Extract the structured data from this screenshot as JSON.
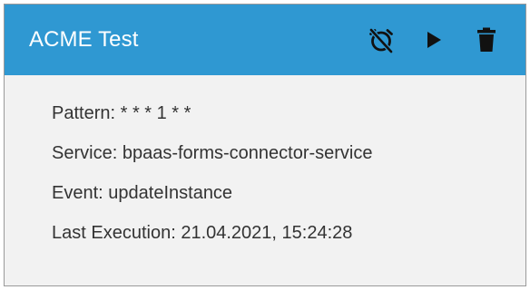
{
  "card": {
    "title": "ACME Test",
    "header_color": "#2f98d2",
    "actions": [
      {
        "name": "alarm-off-icon",
        "semantic": "disable schedule"
      },
      {
        "name": "play-icon",
        "semantic": "run now"
      },
      {
        "name": "trash-icon",
        "semantic": "delete"
      }
    ],
    "fields": {
      "pattern": {
        "label": "Pattern",
        "value": "* * * 1 * *"
      },
      "service": {
        "label": "Service",
        "value": "bpaas-forms-connector-service"
      },
      "event": {
        "label": "Event",
        "value": "updateInstance"
      },
      "last_execution": {
        "label": "Last Execution",
        "value": "21.04.2021, 15:24:28"
      }
    }
  }
}
